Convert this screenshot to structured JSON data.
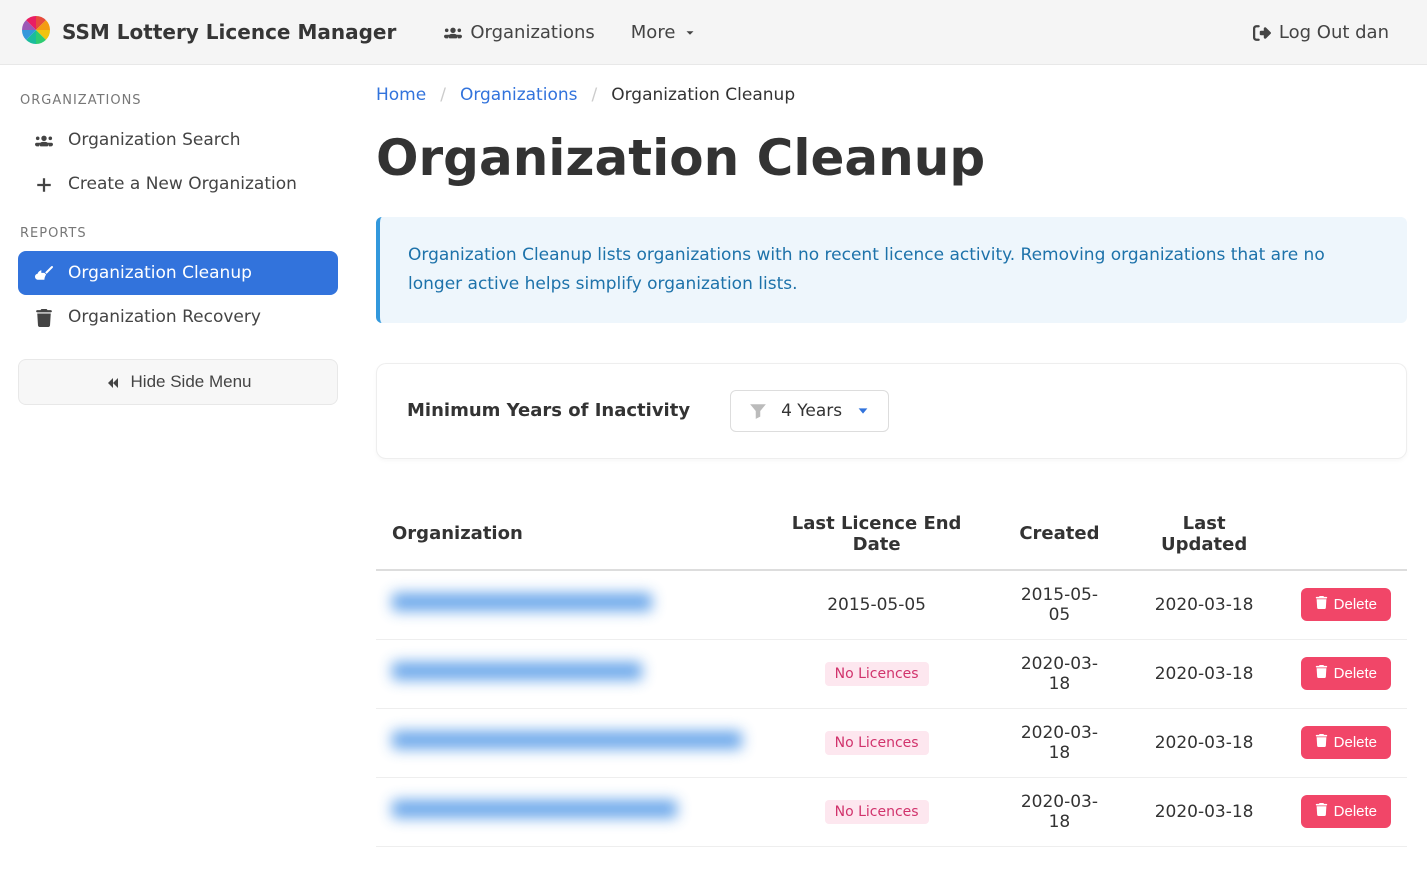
{
  "navbar": {
    "brand": "SSM Lottery Licence Manager",
    "organizations": "Organizations",
    "more": "More",
    "logout": "Log Out dan"
  },
  "sidebar": {
    "heading_orgs": "ORGANIZATIONS",
    "org_search": "Organization Search",
    "create_org": "Create a New Organization",
    "heading_reports": "REPORTS",
    "org_cleanup": "Organization Cleanup",
    "org_recovery": "Organization Recovery",
    "hide_menu": "Hide Side Menu"
  },
  "breadcrumb": {
    "home": "Home",
    "orgs": "Organizations",
    "current": "Organization Cleanup"
  },
  "page": {
    "title": "Organization Cleanup",
    "info": "Organization Cleanup lists organizations with no recent licence activity. Removing organizations that are no longer active helps simplify organization lists."
  },
  "filter": {
    "label": "Minimum Years of Inactivity",
    "selected": "4 Years"
  },
  "table": {
    "headers": {
      "org": "Organization",
      "last_licence": "Last Licence End Date",
      "created": "Created",
      "updated": "Last Updated"
    },
    "no_licences_label": "No Licences",
    "delete_label": "Delete",
    "rows": [
      {
        "last_licence": "2015-05-05",
        "no_licences": false,
        "created": "2015-05-05",
        "updated": "2020-03-18",
        "name_width": 260
      },
      {
        "last_licence": "",
        "no_licences": true,
        "created": "2020-03-18",
        "updated": "2020-03-18",
        "name_width": 250
      },
      {
        "last_licence": "",
        "no_licences": true,
        "created": "2020-03-18",
        "updated": "2020-03-18",
        "name_width": 350
      },
      {
        "last_licence": "",
        "no_licences": true,
        "created": "2020-03-18",
        "updated": "2020-03-18",
        "name_width": 285
      }
    ]
  }
}
